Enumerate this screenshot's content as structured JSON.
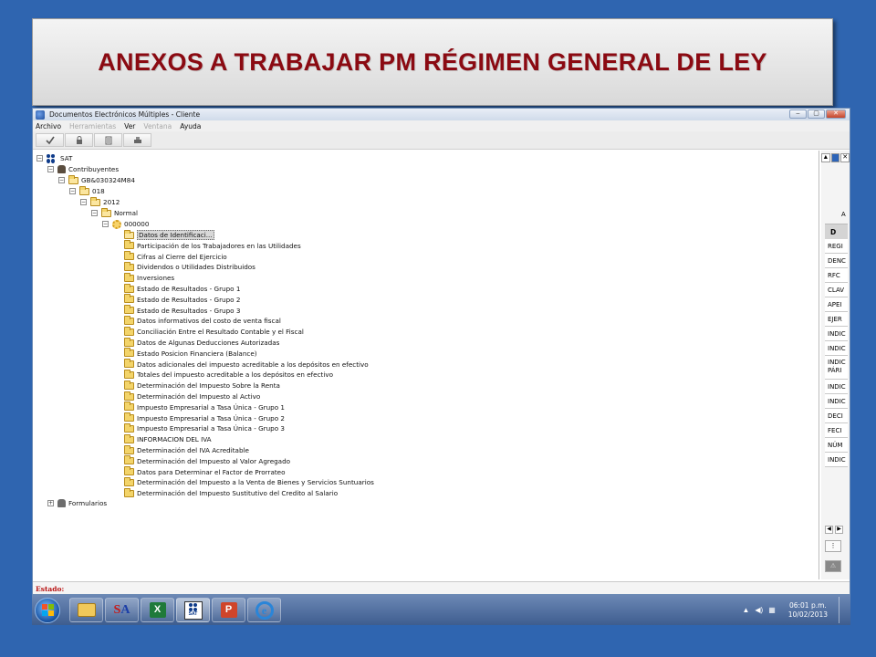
{
  "slide_title": "ANEXOS A TRABAJAR PM RÉGIMEN GENERAL DE LEY",
  "window": {
    "title": "Documentos Electrónicos Múltiples - Cliente"
  },
  "menu": [
    "Archivo",
    "Herramientas",
    "Ver",
    "Ventana",
    "Ayuda"
  ],
  "tree": {
    "root": "SAT",
    "contribuyentes": "Contribuyentes",
    "rfc": "GB&030324M84",
    "ejercicio_code": "018",
    "year": "2012",
    "tipo": "Normal",
    "folio": "000000",
    "anexos": [
      "Datos de Identificaci...",
      "Participación de los Trabajadores en las Utilidades",
      "Cifras al Cierre del Ejercicio",
      "Dividendos o Utilidades Distribuidos",
      "Inversiones",
      "Estado de Resultados - Grupo 1",
      "Estado de Resultados - Grupo 2",
      "Estado de Resultados - Grupo 3",
      "Datos informativos del costo de venta fiscal",
      "Conciliación Entre el Resultado Contable y el Fiscal",
      "Datos de Algunas Deducciones Autorizadas",
      "Estado Posicion Financiera (Balance)",
      "Datos adicionales del impuesto acreditable a los depósitos en efectivo",
      "Totales del impuesto acreditable a los depósitos en efectivo",
      "Determinación del Impuesto Sobre la Renta",
      "Determinación del Impuesto al Activo",
      "Impuesto Empresarial a Tasa Única - Grupo 1",
      "Impuesto Empresarial a Tasa Única - Grupo 2",
      "Impuesto Empresarial a Tasa Única - Grupo 3",
      "INFORMACION DEL IVA",
      "Determinación del IVA Acreditable",
      "Determinación del Impuesto al Valor Agregado",
      "Datos para Determinar el Factor de Prorrateo",
      "Determinación del Impuesto a la Venta de Bienes y Servicios Suntuarios",
      "Determinación del Impuesto Sustitutivo del Credito al Salario"
    ],
    "formularios": "Formularios"
  },
  "right_panel": {
    "letter": "A",
    "header": "D",
    "rows": [
      "REGI",
      "DENC",
      "RFC",
      "CLAV",
      "APEI",
      "EJER",
      "INDIC",
      "INDIC",
      "INDIC PÁRI",
      "INDIC",
      "INDIC",
      "DECI",
      "FECI",
      "NÚM",
      "INDIC"
    ]
  },
  "status_label": "Estado:",
  "clock": {
    "time": "06:01 p.m.",
    "date": "10/02/2013"
  },
  "taskbar_items": [
    "explorer-icon",
    "sa-icon",
    "excel-icon",
    "sat-icon",
    "powerpoint-icon",
    "internet-explorer-icon"
  ],
  "taskbar_text": {
    "sa_s": "S",
    "sa_a": "A",
    "excel": "X",
    "sat": "SAT",
    "ppt": "P",
    "ie": "e"
  },
  "colors": {
    "slide_bg": "#2f65b0",
    "title_text": "#8b0a12",
    "status_text": "#b81313"
  }
}
